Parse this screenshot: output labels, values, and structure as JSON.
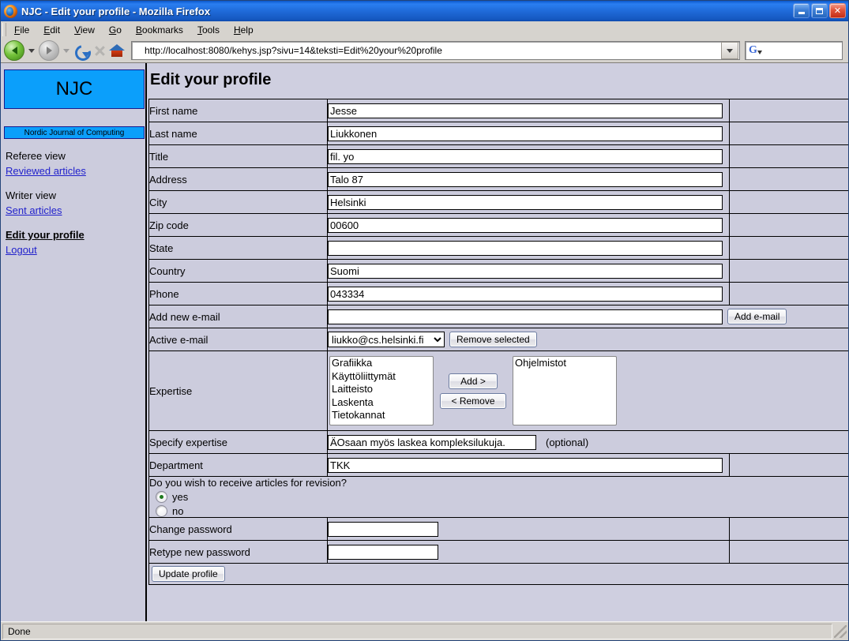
{
  "window": {
    "title": "NJC - Edit your profile - Mozilla Firefox",
    "minimize_label": "Minimize",
    "maximize_label": "Maximize",
    "close_label": "Close"
  },
  "menu": [
    {
      "pre": "",
      "key": "F",
      "post": "ile"
    },
    {
      "pre": "",
      "key": "E",
      "post": "dit"
    },
    {
      "pre": "",
      "key": "V",
      "post": "iew"
    },
    {
      "pre": "",
      "key": "G",
      "post": "o"
    },
    {
      "pre": "",
      "key": "B",
      "post": "ookmarks"
    },
    {
      "pre": "",
      "key": "T",
      "post": "ools"
    },
    {
      "pre": "",
      "key": "H",
      "post": "elp"
    }
  ],
  "toolbar": {
    "back_label": "Back",
    "forward_label": "Forward",
    "reload_label": "Reload",
    "stop_label": "Stop",
    "home_label": "Home",
    "url": "http://localhost:8080/kehys.jsp?sivu=14&teksti=Edit%20your%20profile",
    "search_placeholder": "",
    "search_engine": "G"
  },
  "sidebar": {
    "logo": "NJC",
    "logo_subtitle": "Nordic Journal of Computing",
    "groups": [
      {
        "heading": "Referee view",
        "link": "Reviewed articles"
      },
      {
        "heading": "Writer view",
        "link": "Sent articles"
      }
    ],
    "current_page": "Edit your profile",
    "logout": "Logout"
  },
  "main": {
    "title": "Edit your profile",
    "fields": [
      {
        "label": "First name",
        "value": "Jesse"
      },
      {
        "label": "Last name",
        "value": "Liukkonen"
      },
      {
        "label": "Title",
        "value": "fil. yo"
      },
      {
        "label": "Address",
        "value": "Talo 87"
      },
      {
        "label": "City",
        "value": "Helsinki"
      },
      {
        "label": "Zip code",
        "value": "00600"
      },
      {
        "label": "State",
        "value": ""
      },
      {
        "label": "Country",
        "value": "Suomi"
      },
      {
        "label": "Phone",
        "value": "043334"
      }
    ],
    "add_email": {
      "label": "Add new e-mail",
      "value": "",
      "button": "Add e-mail"
    },
    "active_email": {
      "label": "Active e-mail",
      "selected": "liukko@cs.helsinki.fi",
      "options": [
        "liukko@cs.helsinki.fi"
      ],
      "button": "Remove selected"
    },
    "expertise": {
      "label": "Expertise",
      "available": [
        "Grafiikka",
        "Käyttöliittymät",
        "Laitteisto",
        "Laskenta",
        "Tietokannat"
      ],
      "selected": [
        "Ohjelmistot"
      ],
      "add_button": "Add >",
      "remove_button": "< Remove"
    },
    "specify_expertise": {
      "label": "Specify expertise",
      "value": "ÄOsaan myös laskea kompleksilukuja.",
      "hint": "(optional)"
    },
    "department": {
      "label": "Department",
      "value": "TKK"
    },
    "revision": {
      "question": "Do you wish to receive articles for revision?",
      "yes_label": "yes",
      "no_label": "no",
      "selected": "yes"
    },
    "passwords": [
      {
        "label": "Change password",
        "value": ""
      },
      {
        "label": "Retype new password",
        "value": ""
      }
    ],
    "submit_button": "Update profile"
  },
  "status": {
    "text": "Done"
  }
}
